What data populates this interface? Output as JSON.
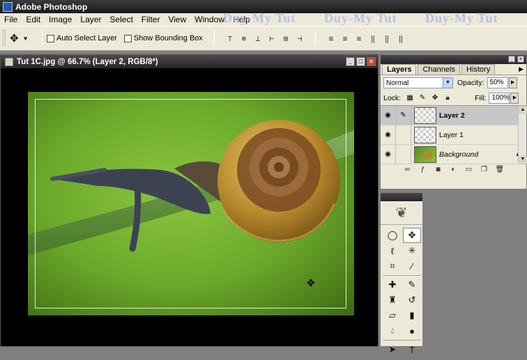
{
  "app": {
    "title": "Adobe Photoshop"
  },
  "menu": [
    "File",
    "Edit",
    "Image",
    "Layer",
    "Select",
    "Filter",
    "View",
    "Window",
    "Help"
  ],
  "watermark": "Duy-My Tut",
  "options": {
    "auto_select_label": "Auto Select Layer",
    "bounding_box_label": "Show Bounding Box"
  },
  "document": {
    "title": "Tut 1C.jpg @ 66.7% (Layer 2, RGB/8*)"
  },
  "layers_panel": {
    "tabs": [
      "Layers",
      "Channels",
      "History"
    ],
    "blend_mode": "Normal",
    "opacity_label": "Opacity:",
    "opacity": "50%",
    "lock_label": "Lock:",
    "fill_label": "Fill:",
    "fill": "100%",
    "layers": [
      {
        "name": "Layer 2",
        "selected": true
      },
      {
        "name": "Layer 1",
        "selected": false
      },
      {
        "name": "Background",
        "selected": false,
        "locked": true
      }
    ]
  },
  "colors": {
    "accent": "#3c3c3c",
    "selected_layer": "#c7c7c7",
    "close_button": "#d24a2e"
  }
}
